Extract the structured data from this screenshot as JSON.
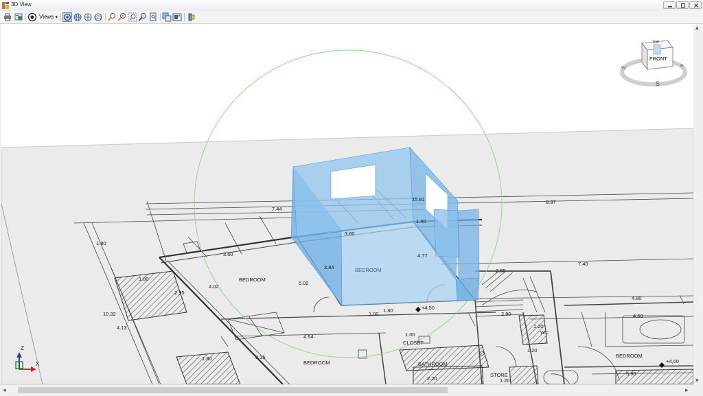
{
  "window": {
    "title": "3D View"
  },
  "toolbar": {
    "views_label": "Views",
    "views_arrow": "▾",
    "icons": [
      "print-icon",
      "settings-icon",
      "render-icon",
      "views-dropdown",
      "orbit-icon",
      "globe-icon",
      "walk-icon",
      "look-around-icon",
      "zoom-in-icon",
      "zoom-out-icon",
      "zoom-window-icon",
      "zoom-extents-icon",
      "zoom-selection-icon",
      "layers-icon",
      "display-icon",
      "section-icon"
    ]
  },
  "viewcube": {
    "top": "TOP",
    "front": "FRONT",
    "w": "W",
    "e": "E",
    "s": "S"
  },
  "axes": {
    "z": "Z",
    "x": "X"
  },
  "plan": {
    "dims": [
      "15.81",
      "8.37",
      "7.44",
      "1.40",
      "3.60",
      "3.60",
      "4.77",
      "3.84",
      "5.02",
      "4.02",
      "7.40",
      "2.80",
      "4.80",
      "4.60",
      "1.80",
      "2.95",
      "1.80",
      "3.35",
      "4.54",
      "1.00",
      "1.00",
      "1.20",
      "2.20",
      "1.20",
      "1.20",
      "5.90",
      "2.80",
      "1.80",
      "10.32",
      "4.13",
      "1.80"
    ],
    "rooms": [
      "BEDROOM",
      "BEDROOM",
      "BEDROOM",
      "BEDROOM",
      "CLOSET",
      "BATHROOM",
      "STORE",
      "WC"
    ],
    "levels": [
      "+4,50",
      "+4,00"
    ]
  },
  "colors": {
    "volume": "#8cc4ec",
    "volume_dark": "#6aaee2",
    "orbit": "#7fd47f",
    "ground": "#ececec"
  }
}
